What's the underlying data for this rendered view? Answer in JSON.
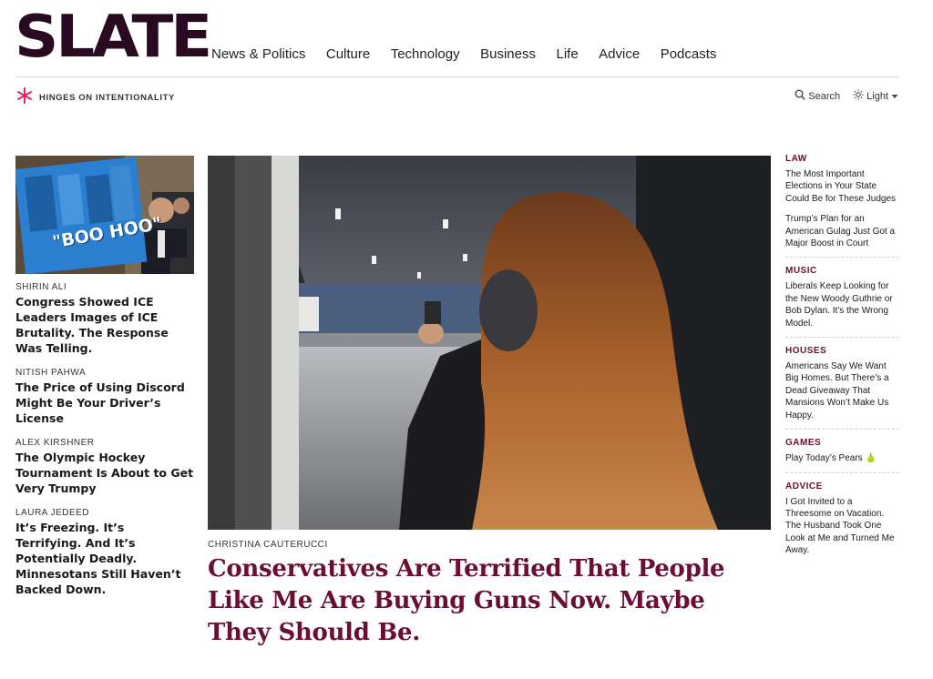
{
  "header": {
    "logo": "SLATE",
    "nav": [
      "News & Politics",
      "Culture",
      "Technology",
      "Business",
      "Life",
      "Advice",
      "Podcasts"
    ],
    "tagline": "HINGES ON INTENTIONALITY",
    "search_label": "Search",
    "theme_label": "Light"
  },
  "left_stories": [
    {
      "byline": "SHIRIN ALI",
      "headline": "Congress Showed ICE Leaders Images of ICE Brutality. The Response Was Telling."
    },
    {
      "byline": "NITISH PAHWA",
      "headline": "The Price of Using Discord Might Be Your Driver’s License"
    },
    {
      "byline": "ALEX KIRSHNER",
      "headline": "The Olympic Hockey Tournament Is About to Get Very Trumpy"
    },
    {
      "byline": "LAURA JEDEED",
      "headline": "It’s Freezing. It’s Terrifying. And It’s Potentially Deadly. Minnesotans Still Haven’t Backed Down."
    }
  ],
  "thumb_sign_text": "\"BOO HOO\"",
  "hero": {
    "byline": "CHRISTINA CAUTERUCCI",
    "headline": "Conservatives Are Terrified That People Like Me Are Buying Guns Now. Maybe They Should Be."
  },
  "right_sections": [
    {
      "category": "LAW",
      "links": [
        "The Most Important Elections in Your State Could Be for These Judges",
        "Trump’s Plan for an American Gulag Just Got a Major Boost in Court"
      ]
    },
    {
      "category": "MUSIC",
      "links": [
        "Liberals Keep Looking for the New Woody Guthrie or Bob Dylan. It’s the Wrong Model."
      ]
    },
    {
      "category": "HOUSES",
      "links": [
        "Americans Say We Want Big Homes. But There’s a Dead Giveaway That Mansions Won’t Make Us Happy."
      ]
    },
    {
      "category": "GAMES",
      "links": [
        "Play Today’s Pears 🍐"
      ]
    },
    {
      "category": "ADVICE",
      "links": [
        "I Got Invited to a Threesome on Vacation. The Husband Took One Look at Me and Turned Me Away."
      ]
    }
  ],
  "colors": {
    "accent": "#6b0d34",
    "logo": "#2a0a20",
    "tagline_icon": "#e0245e"
  }
}
